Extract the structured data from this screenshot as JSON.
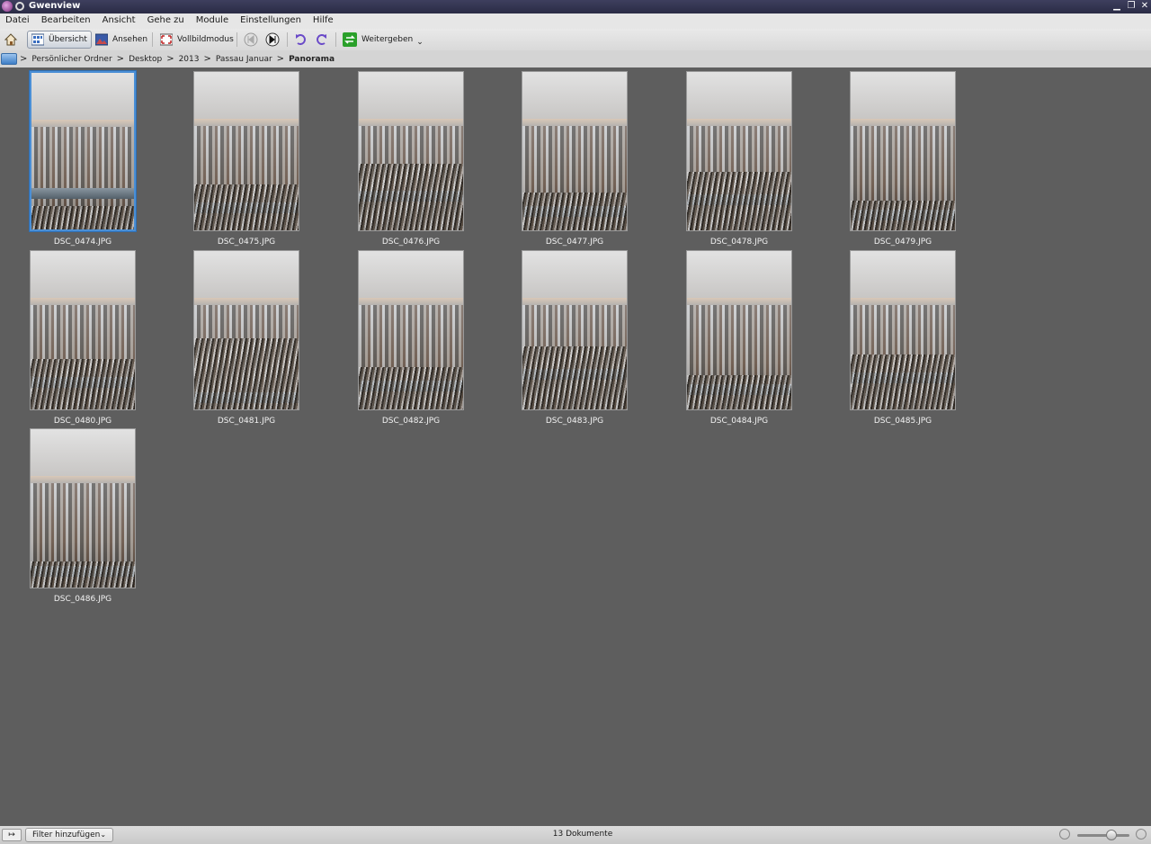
{
  "window": {
    "title": "Gwenview"
  },
  "menubar": {
    "items": [
      "Datei",
      "Bearbeiten",
      "Ansicht",
      "Gehe zu",
      "Module",
      "Einstellungen",
      "Hilfe"
    ]
  },
  "toolbar": {
    "overview_label": "Übersicht",
    "view_label": "Ansehen",
    "fullscreen_label": "Vollbildmodus",
    "share_label": "Weitergeben"
  },
  "breadcrumb": {
    "items": [
      "Persönlicher Ordner",
      "Desktop",
      "2013",
      "Passau Januar"
    ],
    "current": "Panorama"
  },
  "thumbnails": [
    {
      "name": "DSC_0474.JPG",
      "selected": true
    },
    {
      "name": "DSC_0475.JPG"
    },
    {
      "name": "DSC_0476.JPG"
    },
    {
      "name": "DSC_0477.JPG"
    },
    {
      "name": "DSC_0478.JPG"
    },
    {
      "name": "DSC_0479.JPG"
    },
    {
      "name": "DSC_0480.JPG"
    },
    {
      "name": "DSC_0481.JPG"
    },
    {
      "name": "DSC_0482.JPG"
    },
    {
      "name": "DSC_0483.JPG"
    },
    {
      "name": "DSC_0484.JPG"
    },
    {
      "name": "DSC_0485.JPG"
    },
    {
      "name": "DSC_0486.JPG"
    }
  ],
  "statusbar": {
    "filter_label": "Filter hinzufügen",
    "document_count": "13 Dokumente",
    "zoom_level": 0.65
  },
  "colors": {
    "accent": "#4a8fd6",
    "background": "#5e5e5e"
  }
}
